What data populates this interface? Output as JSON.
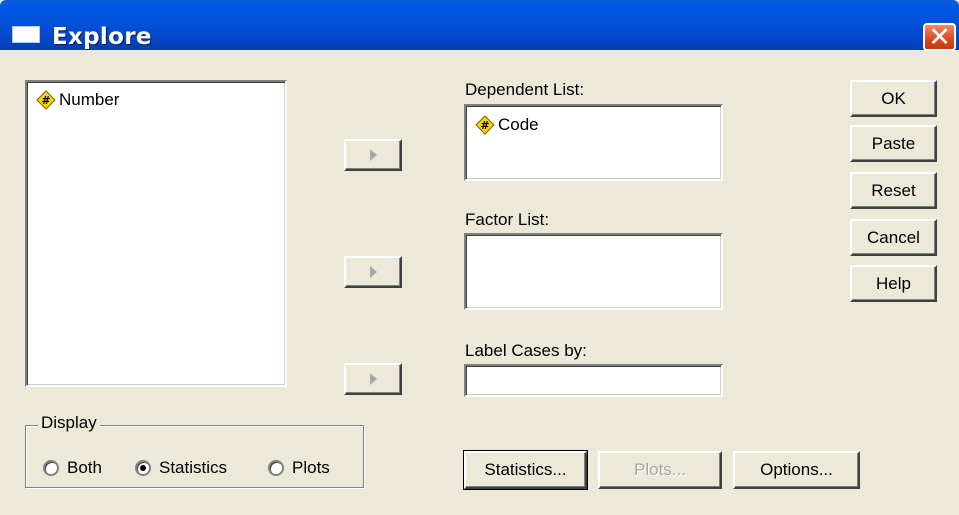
{
  "window": {
    "title": "Explore"
  },
  "source_list": {
    "items": [
      {
        "label": "Number",
        "icon": "numeric-variable-icon"
      }
    ]
  },
  "dependent_list": {
    "label": "Dependent List:",
    "items": [
      {
        "label": "Code",
        "icon": "numeric-variable-icon"
      }
    ]
  },
  "factor_list": {
    "label": "Factor List:"
  },
  "label_cases": {
    "label": "Label Cases by:",
    "value": ""
  },
  "side_buttons": {
    "ok": "OK",
    "paste": "Paste",
    "reset": "Reset",
    "cancel": "Cancel",
    "help": "Help"
  },
  "bottom_buttons": {
    "statistics": "Statistics...",
    "plots": "Plots...",
    "options": "Options..."
  },
  "display": {
    "title": "Display",
    "options": [
      {
        "label": "Both",
        "checked": false
      },
      {
        "label": "Statistics",
        "checked": true
      },
      {
        "label": "Plots",
        "checked": false
      }
    ]
  },
  "colors": {
    "titlebar": "#0451d6",
    "dialog_bg": "#ece9d8",
    "close_button": "#d84a1e"
  }
}
